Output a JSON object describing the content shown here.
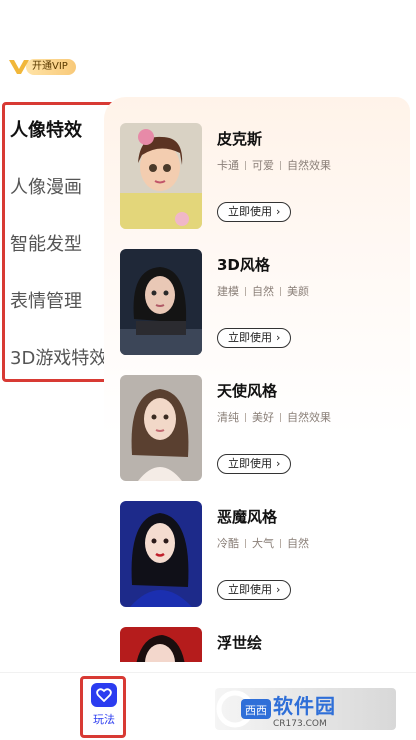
{
  "vip": {
    "label": "开通VIP"
  },
  "sidebar": {
    "items": [
      {
        "label": "人像特效",
        "active": true
      },
      {
        "label": "人像漫画",
        "active": false
      },
      {
        "label": "智能发型",
        "active": false
      },
      {
        "label": "表情管理",
        "active": false
      },
      {
        "label": "3D游戏特效",
        "active": false
      }
    ]
  },
  "cards": [
    {
      "title": "皮克斯",
      "tags": [
        "卡通",
        "可爱",
        "自然效果"
      ],
      "button": "立即使用"
    },
    {
      "title": "3D风格",
      "tags": [
        "建模",
        "自然",
        "美颜"
      ],
      "button": "立即使用"
    },
    {
      "title": "天使风格",
      "tags": [
        "清纯",
        "美好",
        "自然效果"
      ],
      "button": "立即使用"
    },
    {
      "title": "恶魔风格",
      "tags": [
        "冷酷",
        "大气",
        "自然"
      ],
      "button": "立即使用"
    },
    {
      "title": "浮世绘",
      "tags": [],
      "button": ""
    }
  ],
  "tabbar": {
    "play_label": "玩法"
  },
  "watermark": {
    "main": "软件园",
    "sub": "CR173.COM",
    "brand": "西西"
  },
  "colors": {
    "accent": "#2b3cf0",
    "highlight": "#d83a34",
    "vip": "#f8c979"
  }
}
